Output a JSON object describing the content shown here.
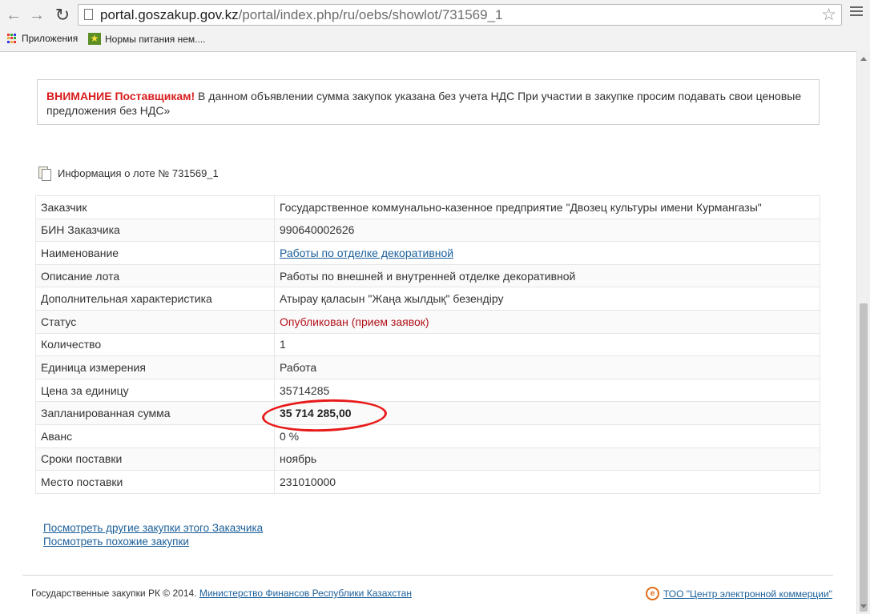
{
  "browser": {
    "url_host": "portal.goszakup.gov.kz",
    "url_path": "/portal/index.php/ru/oebs/showlot/731569_1",
    "bookmarks": [
      {
        "label": "Приложения"
      },
      {
        "label": "Нормы питания нем...."
      }
    ]
  },
  "warning": {
    "prefix": "ВНИМАНИЕ Поставщикам!",
    "text": " В данном объявлении сумма закупок указана без учета НДС  При участии в закупке просим подавать свои ценовые предложения без НДС»"
  },
  "lot": {
    "title": "Информация о лоте № 731569_1"
  },
  "table": {
    "rows": [
      {
        "label": "Заказчик",
        "value": "Государственное коммунально-казенное предприятие \"Двозец культуры имени Курмангазы\""
      },
      {
        "label": "БИН Заказчика",
        "value": "990640002626"
      },
      {
        "label": "Наименование",
        "value": "Работы по отделке декоративной"
      },
      {
        "label": "Описание лота",
        "value": "Работы по внешней и внутренней отделке декоративной"
      },
      {
        "label": "Дополнительная характеристика",
        "value": "Атырау қаласын \"Жаңа жылдық\" безендіру"
      },
      {
        "label": "Статус",
        "value": "Опубликован (прием заявок)"
      },
      {
        "label": "Количество",
        "value": "1"
      },
      {
        "label": "Единица измерения",
        "value": "Работа"
      },
      {
        "label": "Цена за единицу",
        "value": "35714285"
      },
      {
        "label": "Запланированная сумма",
        "value": "35 714 285,00"
      },
      {
        "label": "Аванс",
        "value": "0 %"
      },
      {
        "label": "Сроки поставки",
        "value": "ноябрь"
      },
      {
        "label": "Место поставки",
        "value": "231010000"
      }
    ]
  },
  "links": {
    "other_purchases": "Посмотреть другие закупки этого Заказчика",
    "similar_purchases": "Посмотреть похожие закупки"
  },
  "footer": {
    "copyright": "Государственные закупки РК © 2014. ",
    "ministry_link": "Министерство Финансов Республики Казахстан",
    "ecc_link": "ТОО \"Центр электронной коммерции\""
  },
  "colors": {
    "warning_red": "#d81d1d",
    "status_red": "#b3121b",
    "link_blue": "#1b5f9a",
    "annotation_red": "#e81b1b"
  }
}
